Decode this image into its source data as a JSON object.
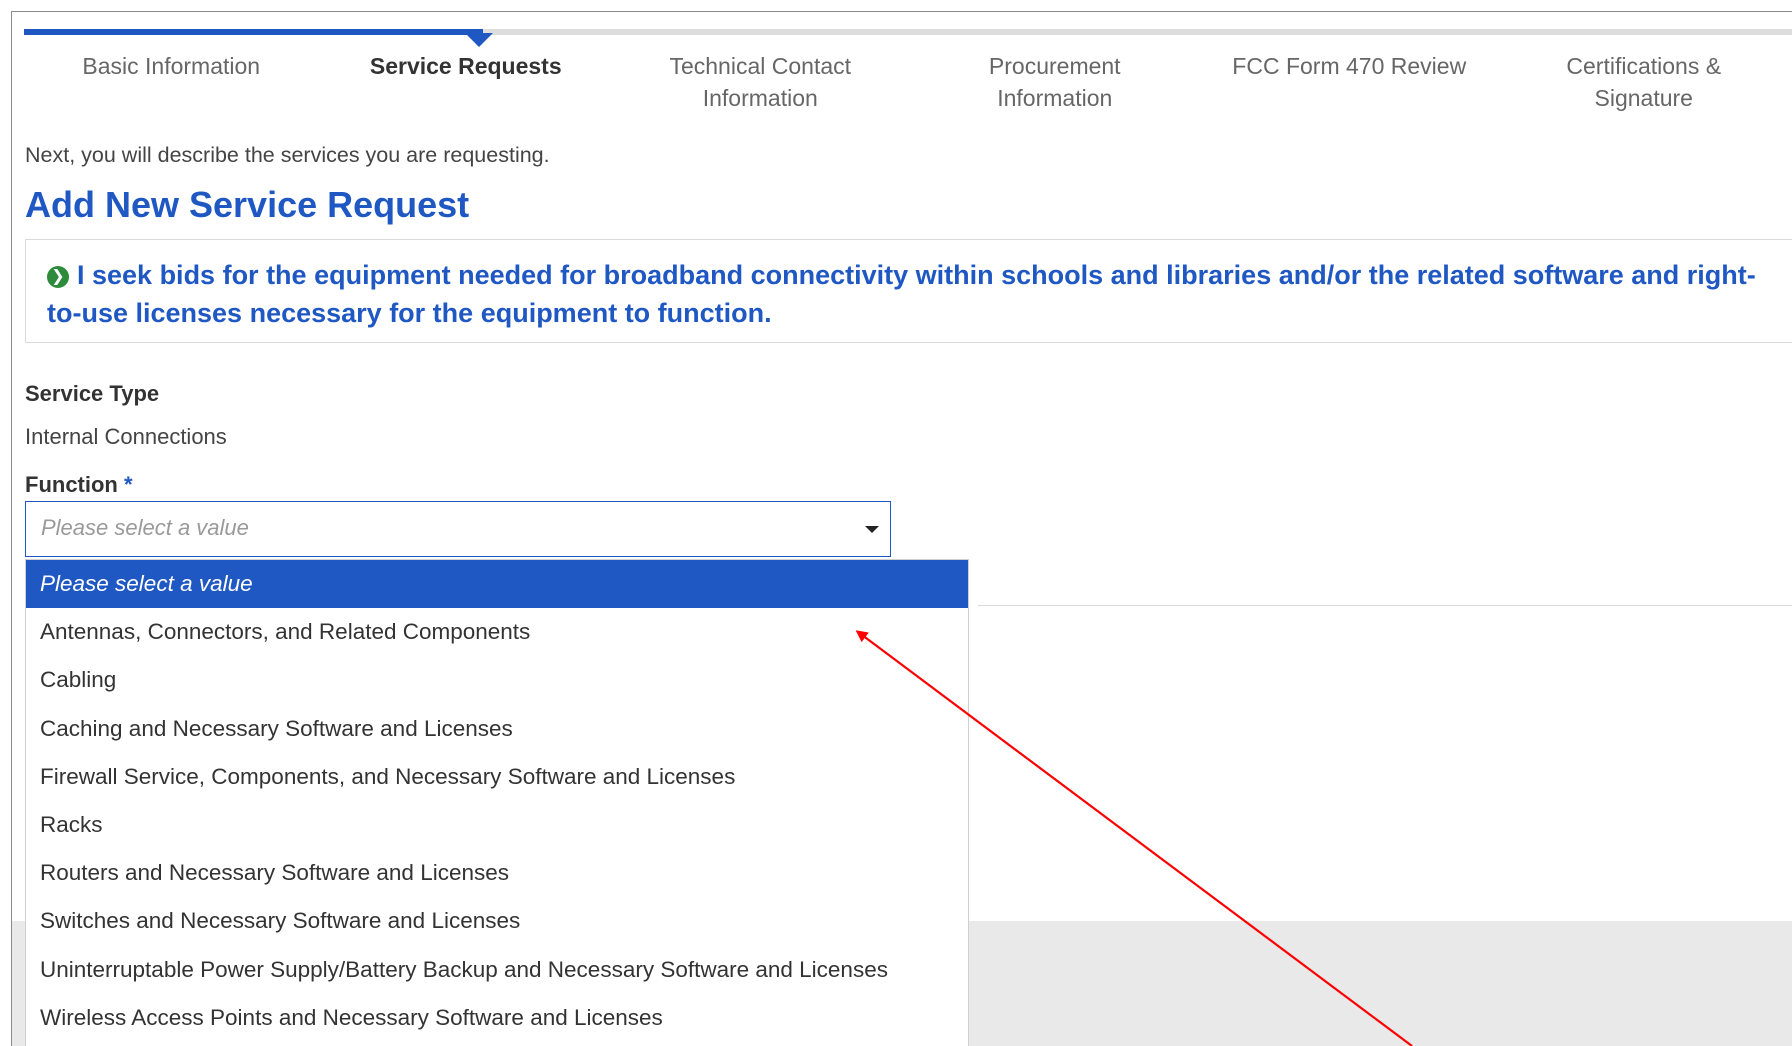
{
  "progress": {
    "steps": [
      {
        "line1": "Basic Information",
        "line2": ""
      },
      {
        "line1": "Service Requests",
        "line2": ""
      },
      {
        "line1": "Technical Contact",
        "line2": "Information"
      },
      {
        "line1": "Procurement",
        "line2": "Information"
      },
      {
        "line1": "FCC Form 470 Review",
        "line2": ""
      },
      {
        "line1": "Certifications &",
        "line2": "Signature"
      }
    ],
    "active_step": "Service Requests"
  },
  "intro_text": "Next, you will describe the services you are requesting.",
  "page_title": "Add New Service Request",
  "callout": {
    "text": "I seek bids for the equipment needed for broadband connectivity within schools and libraries and/or the related software and right-to-use licenses necessary for the equipment to function."
  },
  "service_type": {
    "label": "Service Type",
    "value": "Internal Connections"
  },
  "function": {
    "label": "Function",
    "required_marker": "*",
    "placeholder": "Please select a value",
    "options": [
      "Please select a value",
      "Antennas, Connectors, and Related Components",
      "Cabling",
      "Caching and Necessary Software and Licenses",
      "Firewall Service, Components, and Necessary Software and Licenses",
      "Racks",
      "Routers and Necessary Software and Licenses",
      "Switches and Necessary Software and Licenses",
      "Uninterruptable Power Supply/Battery Backup and Necessary Software and Licenses",
      "Wireless Access Points and Necessary Software and Licenses"
    ],
    "highlighted_option": "Please select a value"
  },
  "colors": {
    "accent": "#1f57c3",
    "check": "#2e8b3b",
    "annotation_arrow": "#ff0000"
  },
  "icons": {
    "callout": "check-circle-icon",
    "select": "caret-down-icon"
  }
}
